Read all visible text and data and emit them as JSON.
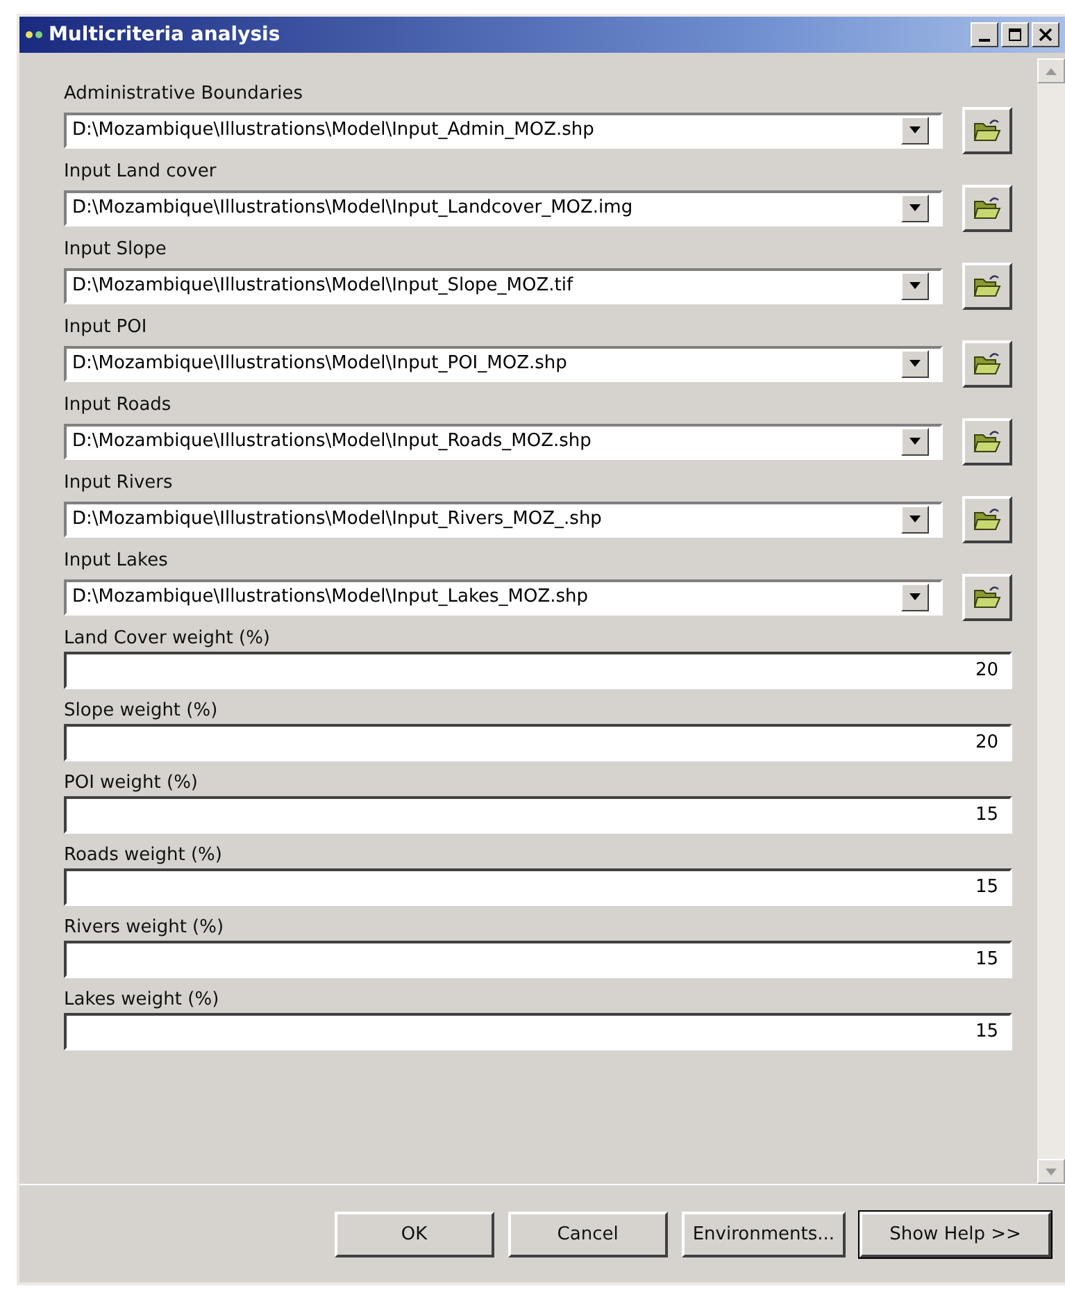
{
  "window": {
    "title": "Multicriteria analysis"
  },
  "inputs": [
    {
      "label": "Administrative Boundaries",
      "value": "D:\\Mozambique\\Illustrations\\Model\\Input_Admin_MOZ.shp"
    },
    {
      "label": "Input Land cover",
      "value": "D:\\Mozambique\\Illustrations\\Model\\Input_Landcover_MOZ.img"
    },
    {
      "label": "Input Slope",
      "value": "D:\\Mozambique\\Illustrations\\Model\\Input_Slope_MOZ.tif"
    },
    {
      "label": "Input POI",
      "value": "D:\\Mozambique\\Illustrations\\Model\\Input_POI_MOZ.shp"
    },
    {
      "label": "Input Roads",
      "value": "D:\\Mozambique\\Illustrations\\Model\\Input_Roads_MOZ.shp"
    },
    {
      "label": "Input Rivers",
      "value": "D:\\Mozambique\\Illustrations\\Model\\Input_Rivers_MOZ_.shp"
    },
    {
      "label": "Input Lakes",
      "value": "D:\\Mozambique\\Illustrations\\Model\\Input_Lakes_MOZ.shp"
    }
  ],
  "weights": [
    {
      "label": "Land Cover weight (%)",
      "value": "20"
    },
    {
      "label": "Slope weight (%)",
      "value": "20"
    },
    {
      "label": "POI weight (%)",
      "value": "15"
    },
    {
      "label": "Roads weight (%)",
      "value": "15"
    },
    {
      "label": "Rivers weight (%)",
      "value": "15"
    },
    {
      "label": "Lakes weight (%)",
      "value": "15"
    }
  ],
  "buttons": [
    {
      "label": "OK",
      "default": false
    },
    {
      "label": "Cancel",
      "default": false
    },
    {
      "label": "Environments...",
      "default": false
    },
    {
      "label": "Show Help >>",
      "default": true
    }
  ]
}
